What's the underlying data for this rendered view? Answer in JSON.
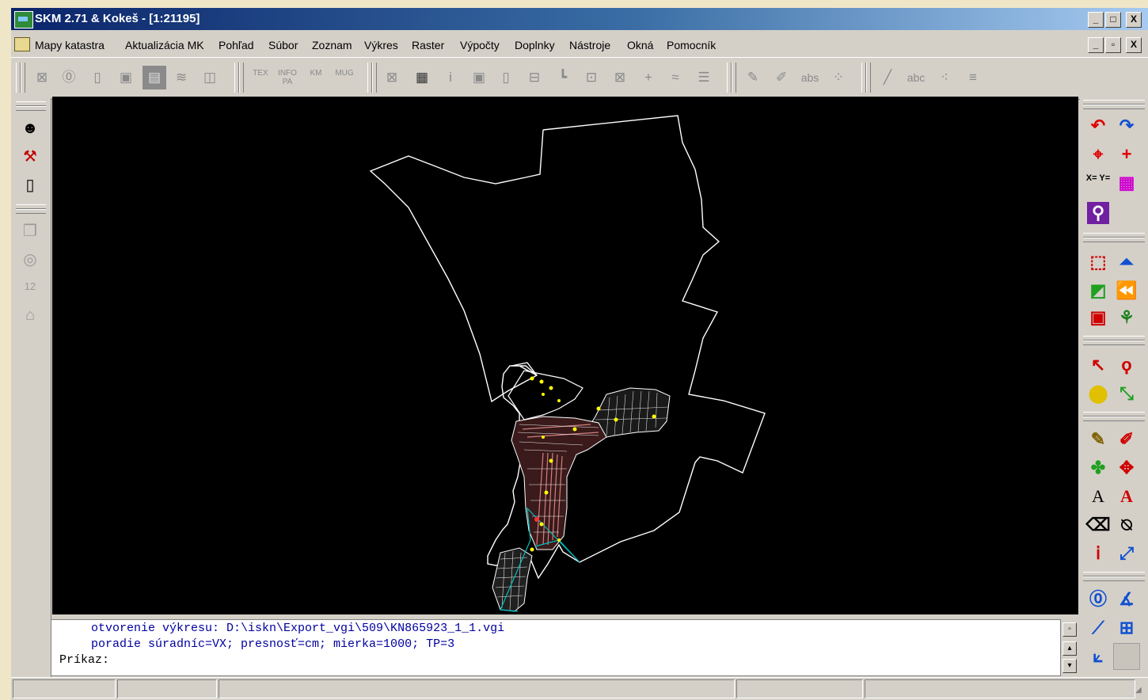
{
  "window": {
    "title": "SKM 2.71 & Kokeš - [1:21195]",
    "controls": {
      "minimize": "_",
      "maximize": "□",
      "close": "X"
    },
    "child_controls": {
      "minimize": "_",
      "restore": "▫",
      "close": "X"
    }
  },
  "menu": {
    "items": [
      "Mapy katastra",
      "Aktualizácia MK",
      "Pohľad",
      "Súbor",
      "Zoznam",
      "Výkres",
      "Raster",
      "Výpočty",
      "Doplnky",
      "Nástroje",
      "Okná",
      "Pomocník"
    ]
  },
  "toolbar": {
    "labels": {
      "info_pa": "INFO PA",
      "km": "KM",
      "mug": "MUG",
      "info_i": "i",
      "abs": "abs",
      "abc": "abc",
      "tex": "TEX"
    }
  },
  "left_toolbar": {
    "numbering_label": "12"
  },
  "right_toolbar": {
    "xy_label": "X= Y=",
    "text_label": "A"
  },
  "command": {
    "lines": [
      "otvorenie výkresu: D:\\iskn\\Export_vgi\\509\\KN865923_1_1.vgi",
      "poradie súradníc=VX; presnosť=cm; mierka=1000; TP=3"
    ],
    "prompt": "Príkaz:"
  },
  "colors": {
    "title_start": "#0a246a",
    "title_end": "#a6caf0",
    "canvas": "#000000",
    "boundary": "#ffffff",
    "parcels": "#d08080",
    "highlight": "#ffff00",
    "cyan_line": "#00c0c0",
    "command_text": "#0000a0"
  },
  "icons": [
    "undo-icon",
    "redo-icon",
    "snap-point-icon",
    "crosshair-icon",
    "coordinates-icon",
    "color-palette-icon",
    "zoom-tool-icon",
    "select-area-icon",
    "pan-up-icon",
    "fill-icon",
    "previous-view-icon",
    "page-icon",
    "tree-icon",
    "pointer-icon",
    "lasso-icon",
    "brush-icon",
    "move-icon",
    "pencil-icon",
    "pen-icon",
    "symbol-icon",
    "symbols-icon",
    "text-icon",
    "text-style-icon",
    "eraser-icon",
    "erase-line-icon",
    "info-icon",
    "transform-icon",
    "parcel-icon",
    "angle-icon",
    "measure-icon",
    "network-icon"
  ]
}
